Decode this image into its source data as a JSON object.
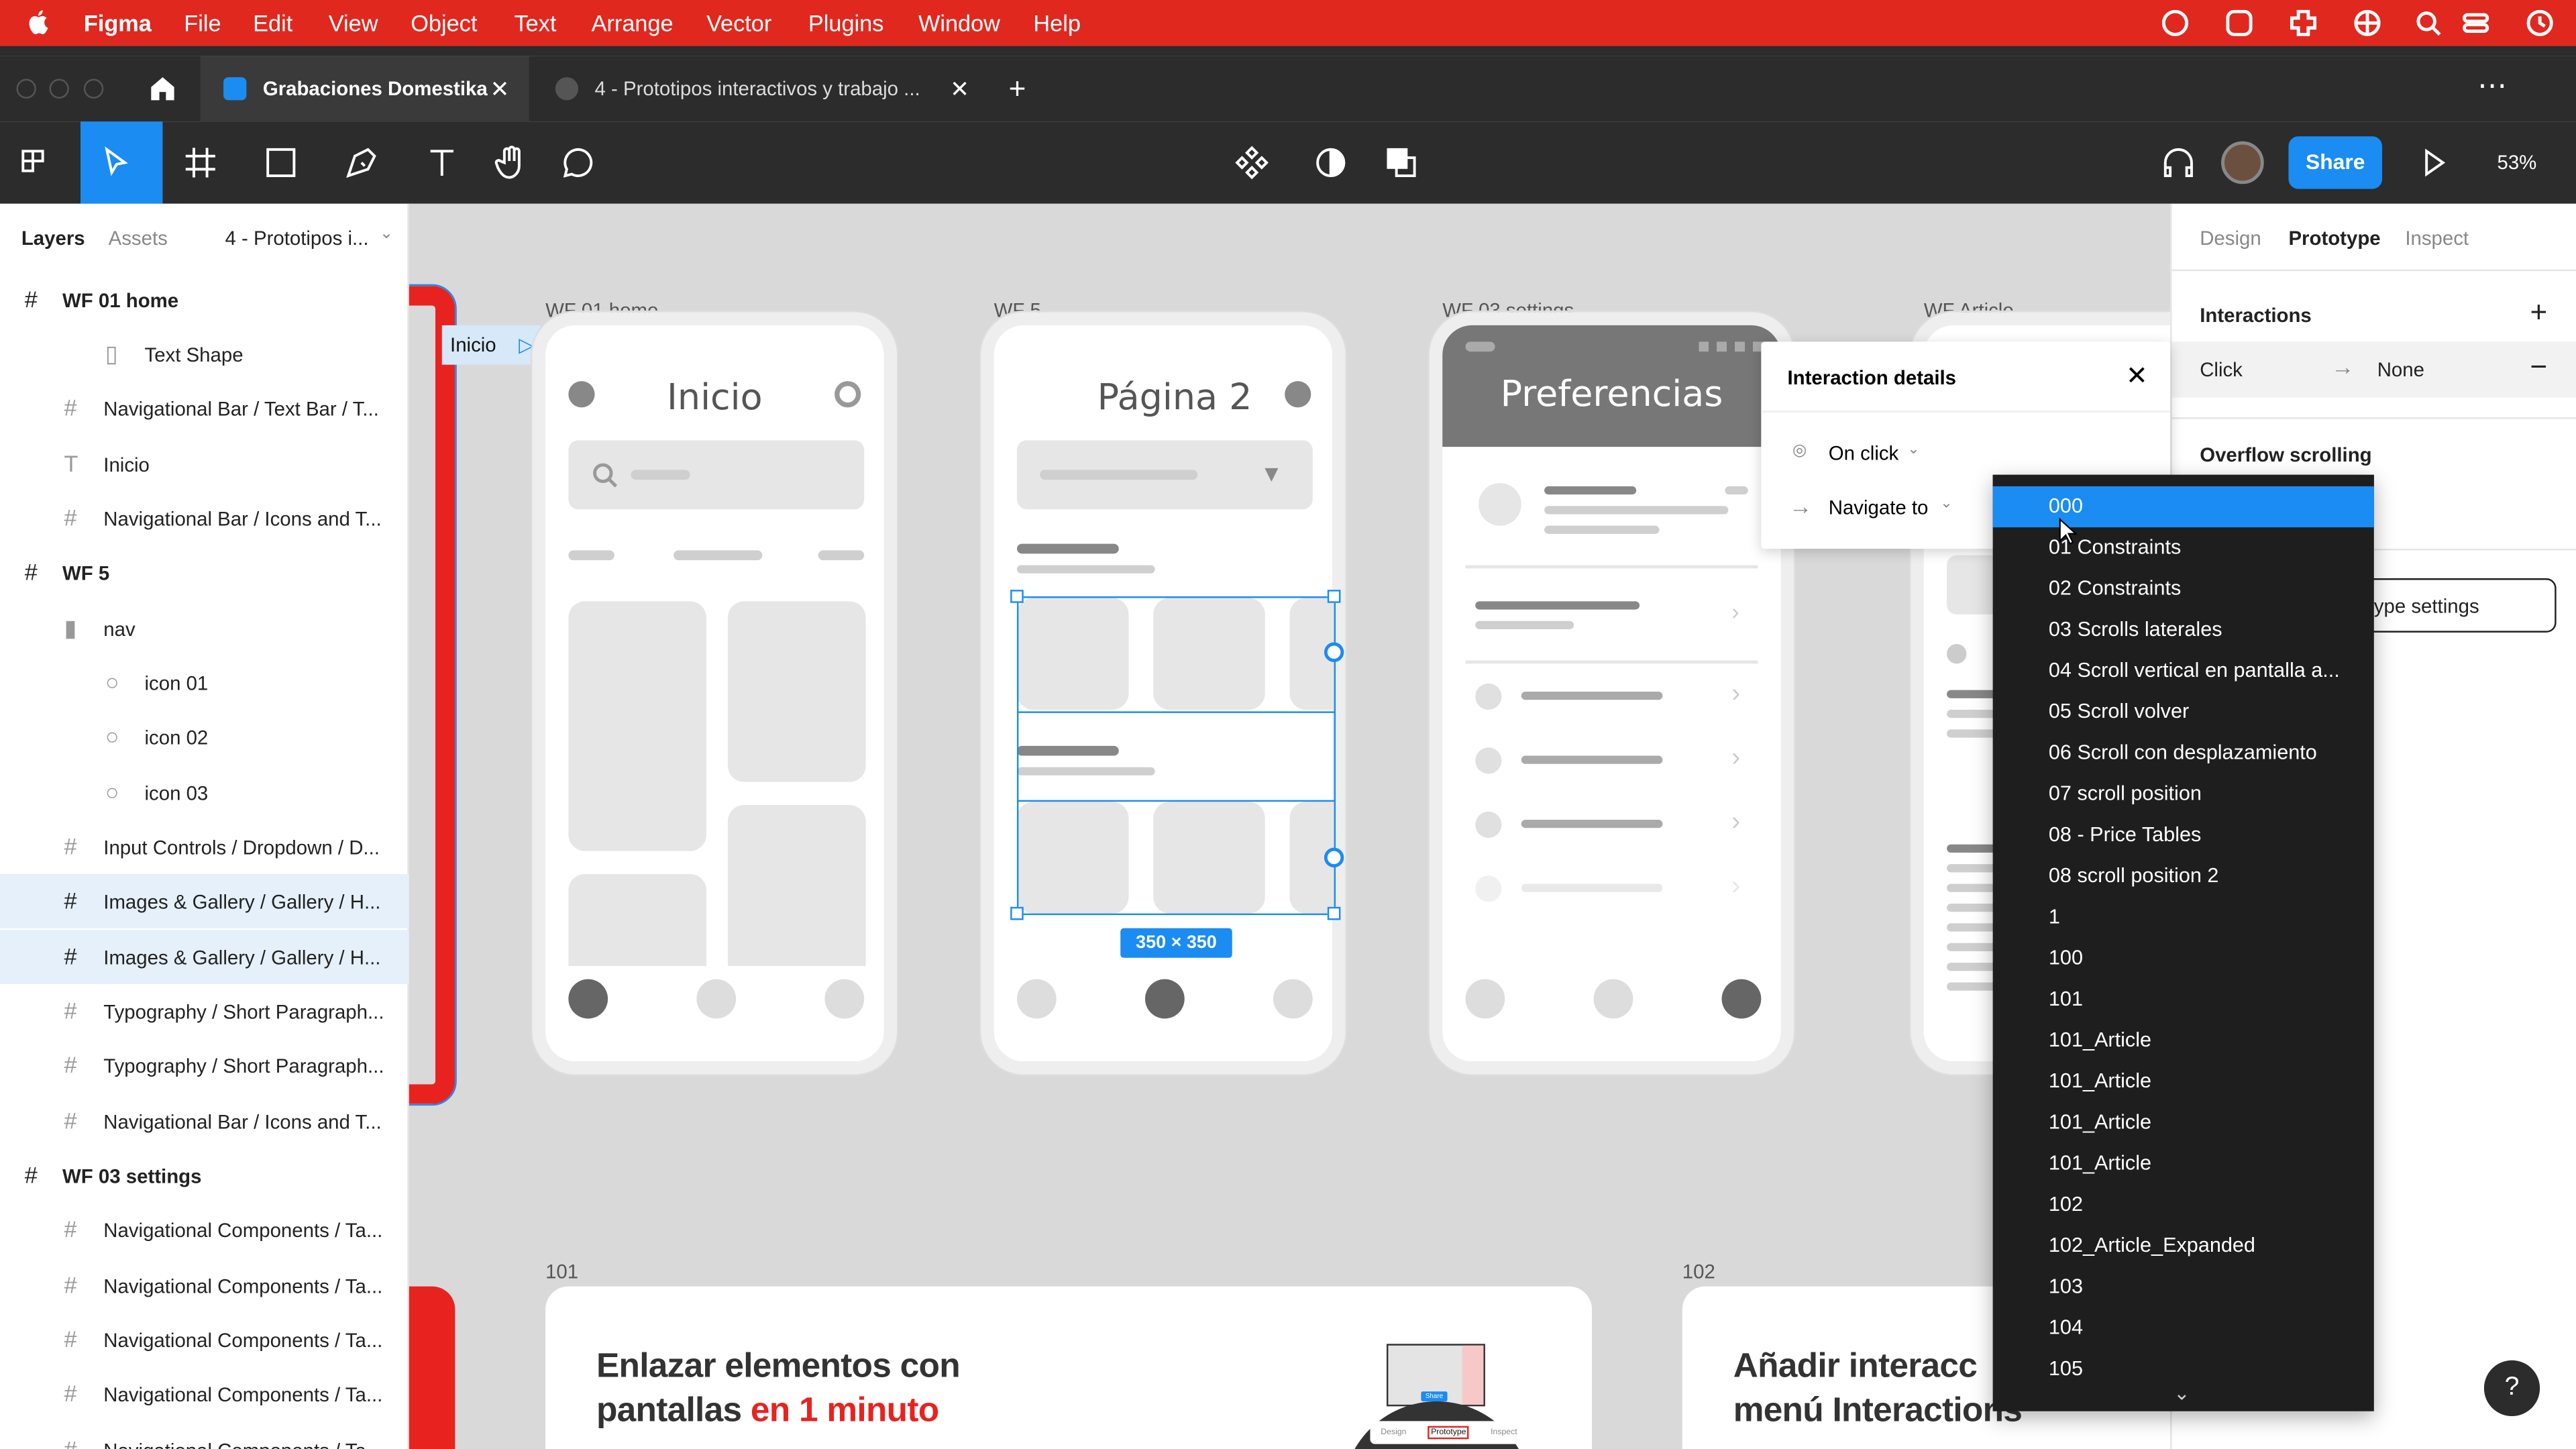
{
  "menubar": {
    "app": "Figma",
    "items": [
      "File",
      "Edit",
      "View",
      "Object",
      "Text",
      "Arrange",
      "Vector",
      "Plugins",
      "Window",
      "Help"
    ]
  },
  "tabs": [
    {
      "label": "Grabaciones Domestika"
    },
    {
      "label": "4 - Prototipos interactivos y trabajo ..."
    }
  ],
  "toolbar": {
    "share": "Share",
    "zoom": "53%"
  },
  "left_panel": {
    "tab_layers": "Layers",
    "tab_assets": "Assets",
    "page": "4 - Prototipos i...",
    "layers": [
      {
        "label": "WF 01 home"
      },
      {
        "label": "Text Shape"
      },
      {
        "label": "Navigational Bar / Text Bar / T..."
      },
      {
        "label": "Inicio"
      },
      {
        "label": "Navigational Bar / Icons and T..."
      },
      {
        "label": "WF 5"
      },
      {
        "label": "nav"
      },
      {
        "label": "icon 01"
      },
      {
        "label": "icon 02"
      },
      {
        "label": "icon 03"
      },
      {
        "label": "Input Controls / Dropdown / D..."
      },
      {
        "label": "Images & Gallery / Gallery / H..."
      },
      {
        "label": "Images & Gallery / Gallery / H..."
      },
      {
        "label": "Typography / Short Paragraph..."
      },
      {
        "label": "Typography / Short Paragraph..."
      },
      {
        "label": "Navigational Bar / Icons and T..."
      },
      {
        "label": "WF 03 settings"
      },
      {
        "label": "Navigational Components / Ta..."
      },
      {
        "label": "Navigational Components / Ta..."
      },
      {
        "label": "Navigational Components / Ta..."
      },
      {
        "label": "Navigational Components / Ta..."
      },
      {
        "label": "Navigational Components / Ta..."
      }
    ]
  },
  "canvas": {
    "flow_start": "Inicio",
    "frames": [
      {
        "label": "WF 01 home",
        "title": "Inicio"
      },
      {
        "label": "WF 5",
        "title": "Página 2"
      },
      {
        "label": "WF 03 settings",
        "title": "Preferencias"
      },
      {
        "label": "WF Article"
      }
    ],
    "selection_size": "350 × 350",
    "bottom_labels": [
      "101",
      "102"
    ],
    "card1_line1": "Enlazar elementos con",
    "card1_line2a": "pantallas ",
    "card1_line2b": "en 1 minuto",
    "card2_line1": "Añadir interacc",
    "card2_line2": "menú Interactions",
    "mini_tabs": [
      "Design",
      "Prototype",
      "Inspect"
    ],
    "mini_share": "Share"
  },
  "right_panel": {
    "tabs": [
      "Design",
      "Prototype",
      "Inspect"
    ],
    "interactions": "Interactions",
    "trigger": "Click",
    "target": "None",
    "overflow": "Overflow scrolling",
    "settings_btn": "ype settings"
  },
  "interaction_popup": {
    "title": "Interaction details",
    "trigger": "On click",
    "action": "Navigate to"
  },
  "dropdown": {
    "items": [
      "000",
      "01 Constraints",
      "02 Constraints",
      "03 Scrolls laterales",
      "04 Scroll vertical en pantalla a...",
      "05 Scroll volver",
      "06 Scroll con desplazamiento",
      "07 scroll position",
      "08 - Price Tables",
      "08 scroll position 2",
      "1",
      "100",
      "101",
      "101_Article",
      "101_Article",
      "101_Article",
      "101_Article",
      "102",
      "102_Article_Expanded",
      "103",
      "104",
      "105"
    ]
  },
  "help": "?",
  "colors": {
    "accent": "#1a8cf2",
    "menubar": "#e0281f",
    "brand": "#e8231f"
  }
}
